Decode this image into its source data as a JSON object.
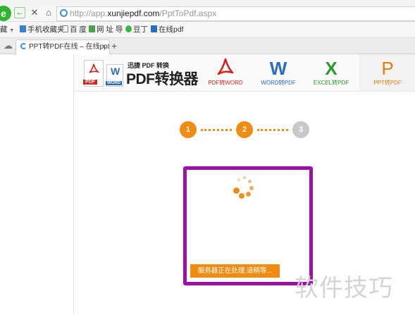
{
  "browser": {
    "url_prefix": "http://app.",
    "url_domain": "xunjiepdf.com",
    "url_path": "/PptToPdf.aspx",
    "favorites": [
      {
        "label": "藏",
        "icon": "favorites-icon"
      },
      {
        "label": "手机收藏夹",
        "icon": "phone-icon"
      },
      {
        "label": "百 度",
        "icon": "page-icon"
      },
      {
        "label": "网 址 导",
        "icon": "site-nav-icon"
      },
      {
        "label": "豆丁",
        "icon": "docin-icon"
      },
      {
        "label": "在线pdf",
        "icon": "pdf-icon"
      }
    ],
    "tab": {
      "title": "PPT转PDF在线 – 在线ppt",
      "close": "×"
    },
    "new_tab": "+"
  },
  "site": {
    "brand_small": "迅捷 PDF 转换",
    "brand_big": "PDF转换器",
    "pdf_badge": "PDF",
    "word_badge": "WORD",
    "tools": [
      {
        "label": "PDF转WORD",
        "glyph": "pdf-icon",
        "color": "#d8261c"
      },
      {
        "label": "WORD转PDF",
        "glyph": "W",
        "color": "#2b6cc4"
      },
      {
        "label": "EXCEL转PDF",
        "glyph": "X",
        "color": "#2e9a2e"
      },
      {
        "label": "PPT转PDF",
        "glyph": "P",
        "color": "#e07e14"
      }
    ]
  },
  "steps": [
    "1",
    "2",
    "3"
  ],
  "progress": {
    "status": "服务器正在处理,请稍等..."
  },
  "colors": {
    "accent": "#f08c12",
    "inactive": "#c8c8c8",
    "highlight": "#9b12a8"
  },
  "watermark": "软件技巧"
}
